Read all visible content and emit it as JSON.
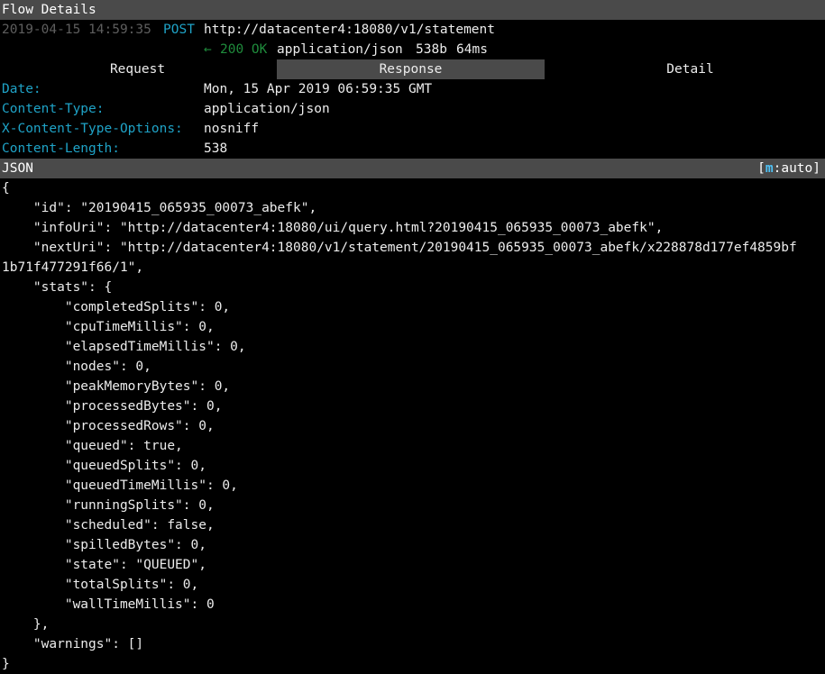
{
  "titlebar": {
    "title": "Flow Details"
  },
  "request_line": {
    "timestamp": "2019-04-15 14:59:35",
    "method": "POST",
    "url": "http://datacenter4:18080/v1/statement"
  },
  "response_line": {
    "arrow": "←",
    "status": "200 OK",
    "content_type": "application/json",
    "size": "538b",
    "time": "64ms"
  },
  "tabs": [
    {
      "label": "Request"
    },
    {
      "label": "Response"
    },
    {
      "label": "Detail"
    }
  ],
  "headers": [
    {
      "name": "Date:",
      "value": "Mon, 15 Apr 2019 06:59:35 GMT"
    },
    {
      "name": "Content-Type:",
      "value": "application/json"
    },
    {
      "name": "X-Content-Type-Options:",
      "value": "nosniff"
    },
    {
      "name": "Content-Length:",
      "value": "538"
    }
  ],
  "body_bar": {
    "label": "JSON",
    "mode_open": "[",
    "mode_key": "m",
    "mode_rest": ":auto]"
  },
  "json_lines": [
    "{",
    "    \"id\": \"20190415_065935_00073_abefk\",",
    "    \"infoUri\": \"http://datacenter4:18080/ui/query.html?20190415_065935_00073_abefk\",",
    "    \"nextUri\": \"http://datacenter4:18080/v1/statement/20190415_065935_00073_abefk/x228878d177ef4859bf",
    "1b71f477291f66/1\",",
    "    \"stats\": {",
    "        \"completedSplits\": 0,",
    "        \"cpuTimeMillis\": 0,",
    "        \"elapsedTimeMillis\": 0,",
    "        \"nodes\": 0,",
    "        \"peakMemoryBytes\": 0,",
    "        \"processedBytes\": 0,",
    "        \"processedRows\": 0,",
    "        \"queued\": true,",
    "        \"queuedSplits\": 0,",
    "        \"queuedTimeMillis\": 0,",
    "        \"runningSplits\": 0,",
    "        \"scheduled\": false,",
    "        \"spilledBytes\": 0,",
    "        \"state\": \"QUEUED\",",
    "        \"totalSplits\": 0,",
    "        \"wallTimeMillis\": 0",
    "    },",
    "    \"warnings\": []",
    "}"
  ],
  "colors": {
    "bar_bg": "#4a4a4a",
    "dim_text": "#5e5e5e",
    "cyan": "#1fa3c7",
    "green": "#1f8c3c",
    "mode_key": "#4fc3f7"
  }
}
